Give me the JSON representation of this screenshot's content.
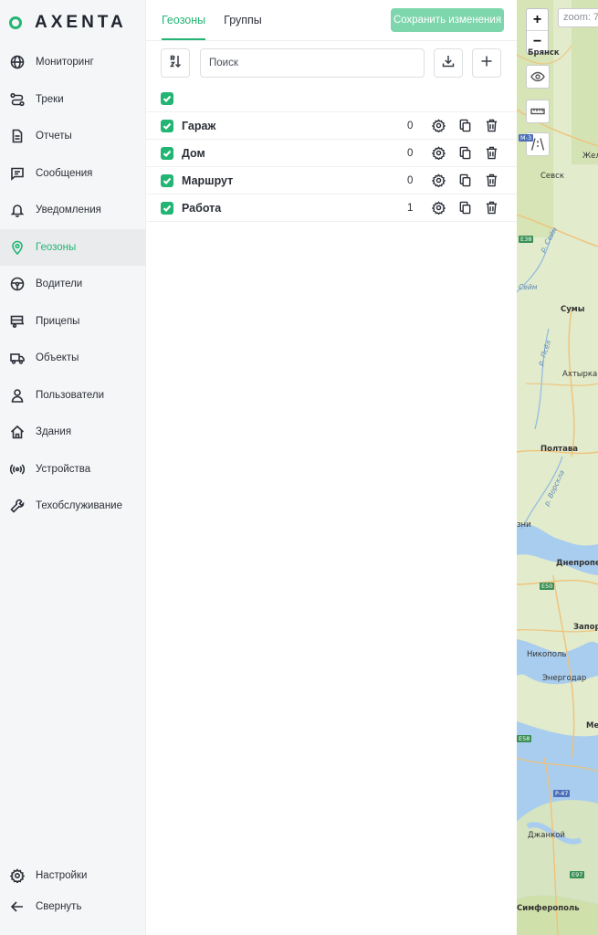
{
  "brand": {
    "name": "AXENTA",
    "accent": "#22b573"
  },
  "sidebar": {
    "items": [
      {
        "label": "Мониторинг",
        "icon": "globe-icon"
      },
      {
        "label": "Треки",
        "icon": "route-icon"
      },
      {
        "label": "Отчеты",
        "icon": "document-icon"
      },
      {
        "label": "Сообщения",
        "icon": "message-icon"
      },
      {
        "label": "Уведомления",
        "icon": "bell-icon"
      },
      {
        "label": "Геозоны",
        "icon": "map-pin-icon",
        "active": true
      },
      {
        "label": "Водители",
        "icon": "steering-wheel-icon"
      },
      {
        "label": "Прицепы",
        "icon": "trailer-icon"
      },
      {
        "label": "Объекты",
        "icon": "truck-icon"
      },
      {
        "label": "Пользователи",
        "icon": "user-icon"
      },
      {
        "label": "Здания",
        "icon": "home-icon"
      },
      {
        "label": "Устройства",
        "icon": "broadcast-icon"
      },
      {
        "label": "Техобслуживание",
        "icon": "wrench-icon"
      }
    ],
    "bottom": [
      {
        "label": "Настройки",
        "icon": "gear-icon"
      },
      {
        "label": "Свернуть",
        "icon": "arrow-left-icon"
      }
    ]
  },
  "tabs": [
    {
      "label": "Геозоны",
      "active": true
    },
    {
      "label": "Группы",
      "active": false
    }
  ],
  "toolbar": {
    "save_label": "Сохранить изменения",
    "search_placeholder": "Поиск"
  },
  "geozones": [
    {
      "name": "Гараж",
      "count": "0",
      "checked": true
    },
    {
      "name": "Дом",
      "count": "0",
      "checked": true
    },
    {
      "name": "Маршрут",
      "count": "0",
      "checked": true
    },
    {
      "name": "Работа",
      "count": "1",
      "checked": true
    }
  ],
  "map": {
    "zoom_in": "+",
    "zoom_out": "−",
    "zoom_label": "zoom: 7",
    "cities": [
      "Брянск",
      "Севск",
      "Жел",
      "Сумы",
      "Ахтырка",
      "Полтава",
      "Днепропет",
      "Запор",
      "Никополь",
      "Энергодар",
      "Ме",
      "Джанкой",
      "Симферополь",
      "зни"
    ],
    "roads": [
      "M-3",
      "E38",
      "E50",
      "E58",
      "P-47",
      "E97"
    ],
    "rivers": [
      "р. Сейм",
      "Сейм",
      "р. Псёл",
      "р. Ворскла"
    ]
  }
}
